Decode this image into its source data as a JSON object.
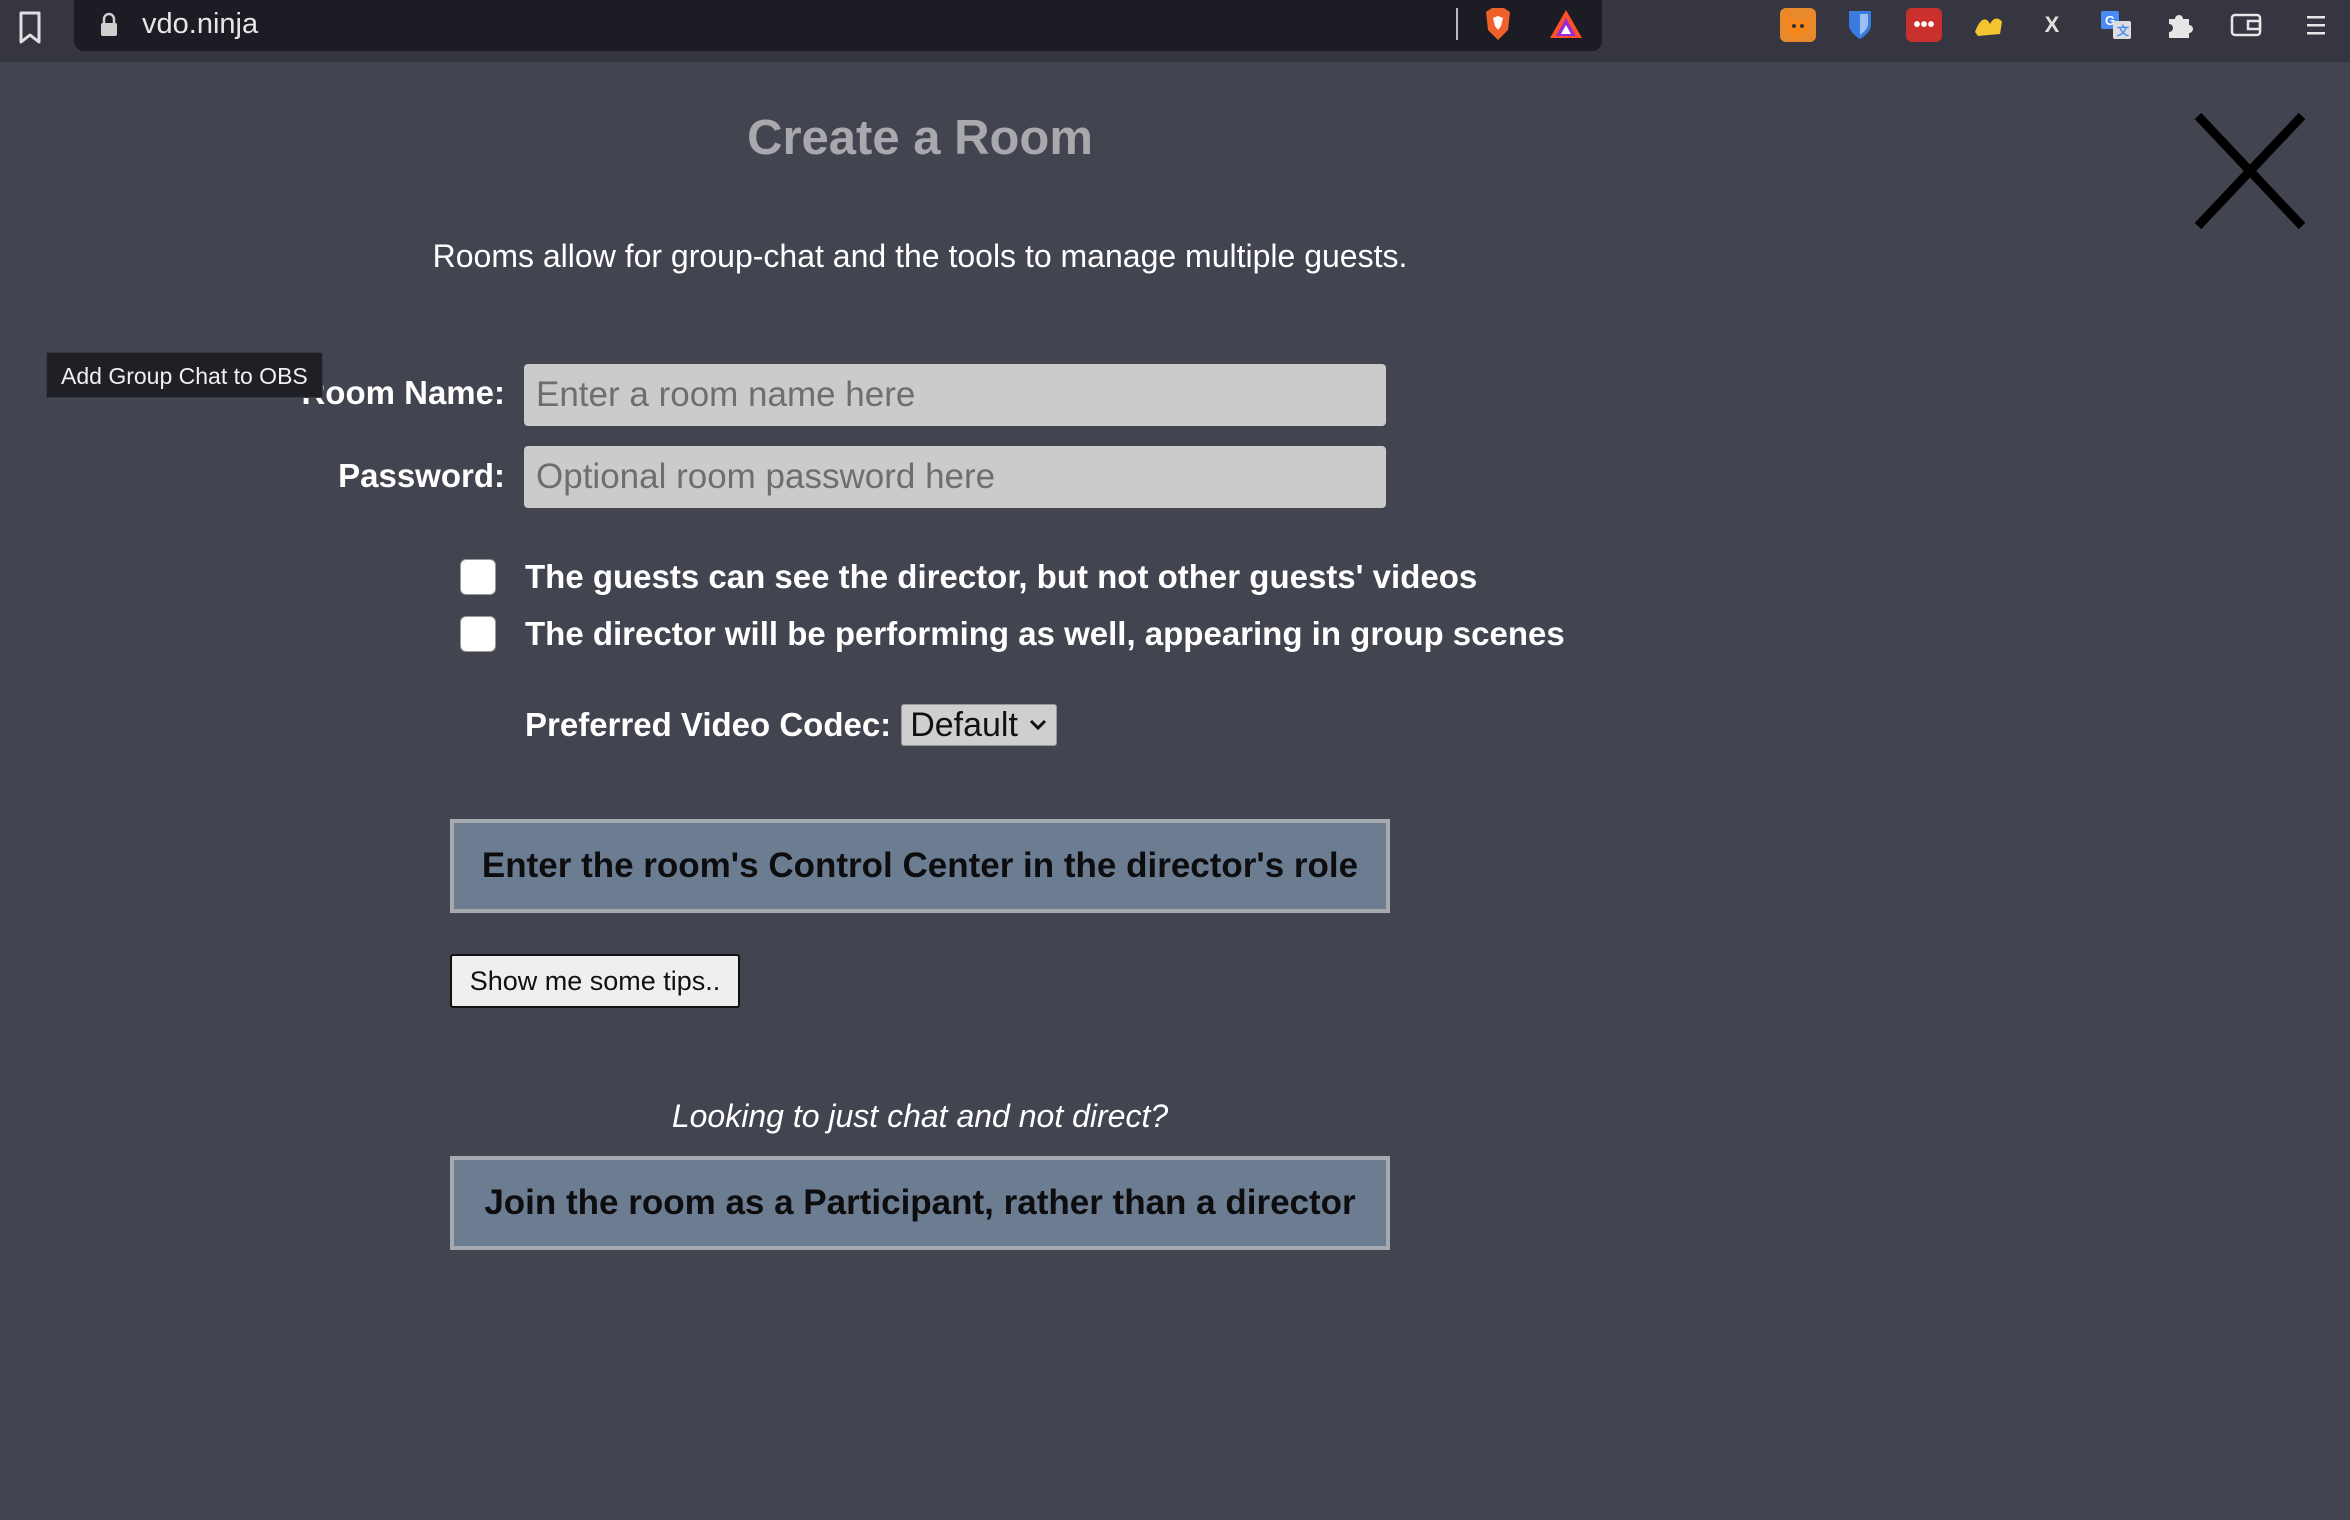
{
  "browser": {
    "url": "vdo.ninja",
    "extensions": [
      "metamask-icon",
      "bitwarden-icon",
      "lastpass-icon",
      "signer-icon",
      "x-extension-icon",
      "google-translate-icon",
      "extensions-puzzle-icon",
      "wallet-icon",
      "menu-icon"
    ]
  },
  "modal": {
    "title": "Create a Room",
    "subtitle": "Rooms allow for group-chat and the tools to manage multiple guests.",
    "tooltip": "Add Group Chat to OBS",
    "room_name_label": "Room Name:",
    "room_name_placeholder": "Enter a room name here",
    "password_label": "Password:",
    "password_placeholder": "Optional room password here",
    "checkboxes": [
      {
        "label": "The guests can see the director, but not other guests' videos",
        "checked": false
      },
      {
        "label": "The director will be performing as well, appearing in group scenes",
        "checked": false
      }
    ],
    "codec_label": "Preferred Video Codec:",
    "codec_value": "Default",
    "director_button": "Enter the room's Control Center in the director's role",
    "tips_button": "Show me some tips..",
    "chat_hint": "Looking to just chat and not direct?",
    "participant_button": "Join the room as a Participant, rather than a director"
  },
  "colors": {
    "background": "#42444f",
    "button_primary": "#6c7d92",
    "input_bg": "#cbcbcb"
  }
}
